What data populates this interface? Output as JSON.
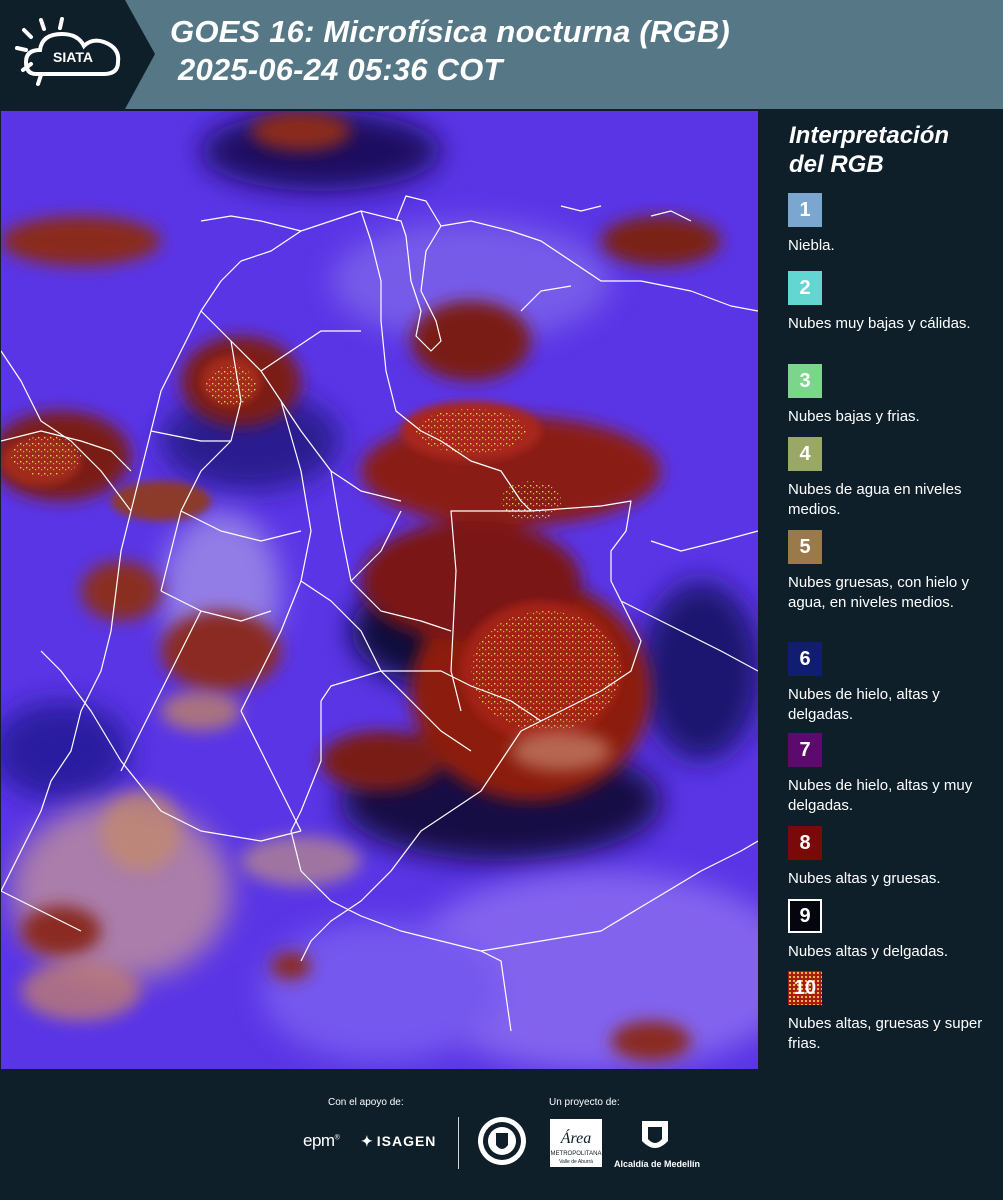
{
  "header": {
    "logo_text": "SIATA",
    "title_line1": "GOES 16: Microfísica nocturna (RGB)",
    "title_line2": "2025-06-24 05:36 COT",
    "background_color": "#557786"
  },
  "map": {
    "image_description_icon": "satellite-rgb-nighttime-microphysics-image",
    "boundary_color": "#ffffff"
  },
  "legend": {
    "title": "Interpretación del RGB",
    "items": [
      {
        "number": "1",
        "label": "Niebla.",
        "color": "#7aa6cf"
      },
      {
        "number": "2",
        "label": "Nubes muy bajas y cálidas.",
        "color": "#63d6d2"
      },
      {
        "number": "3",
        "label": "Nubes bajas y frias.",
        "color": "#7bd68c"
      },
      {
        "number": "4",
        "label": "Nubes de agua en niveles medios.",
        "color": "#9aa867"
      },
      {
        "number": "5",
        "label": "Nubes gruesas, con hielo y agua, en niveles medios.",
        "color": "#9a7a4a"
      },
      {
        "number": "6",
        "label": "Nubes de hielo, altas y delgadas.",
        "color": "#101d70"
      },
      {
        "number": "7",
        "label": "Nubes de hielo, altas y muy delgadas.",
        "color": "#5b0b6e"
      },
      {
        "number": "8",
        "label": "Nubes altas y gruesas.",
        "color": "#7a0a0a"
      },
      {
        "number": "9",
        "label": "Nubes altas y delgadas.",
        "color": "#050510"
      },
      {
        "number": "10",
        "label": "Nubes altas, gruesas y super frias.",
        "color": "#a81a10"
      }
    ]
  },
  "footer": {
    "support_caption": "Con el apoyo de:",
    "project_caption": "Un proyecto de:",
    "sponsor_1": "epm",
    "sponsor_2": "ISAGEN",
    "area_logo_text": "Área",
    "area_subtext": "METROPOLITANA",
    "area_subtext2": "Valle de Aburrá",
    "medellin_caption": "Alcaldía de Medellín"
  }
}
